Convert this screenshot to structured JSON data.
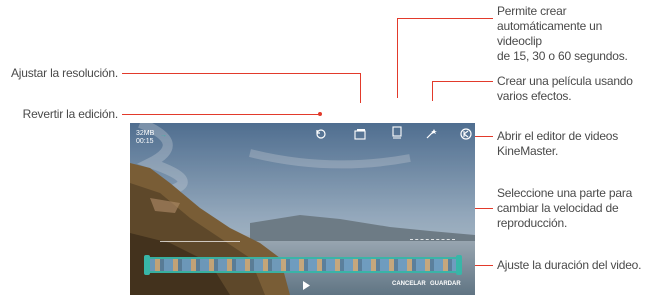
{
  "annotations": {
    "resolution": "Ajustar la resolución.",
    "undo": "Revertir la edición.",
    "auto_clip": [
      "Permite crear",
      "automáticamente un videoclip",
      "de 15, 30 o 60 segundos."
    ],
    "movie": [
      "Crear una película usando",
      "varios efectos."
    ],
    "kinemaster": [
      "Abrir el editor de videos",
      "KineMaster."
    ],
    "speed": [
      "Seleccione una parte para",
      "cambiar la velocidad de",
      "reproducción."
    ],
    "duration": "Ajuste la duración del video."
  },
  "screen": {
    "file_size": "32MB",
    "elapsed": "00:15",
    "cancel": "CANCELAR",
    "save": "GUARDAR"
  },
  "icons": [
    "undo-icon",
    "resolution-icon",
    "auto-clip-icon",
    "movie-effects-icon",
    "kinemaster-icon",
    "play-icon"
  ],
  "colors": {
    "callout_line": "#e23a2b",
    "trim_handle": "#38b6a8"
  }
}
